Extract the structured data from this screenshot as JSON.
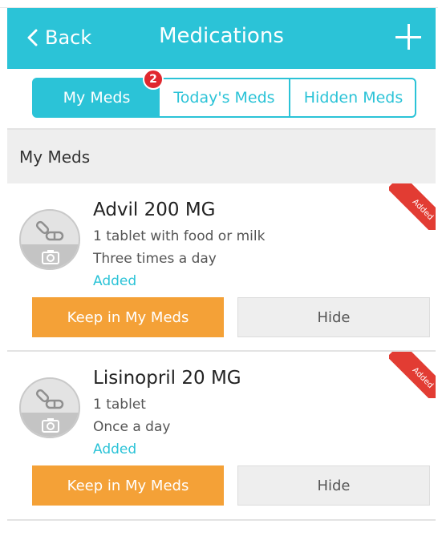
{
  "header": {
    "back_label": "Back",
    "title": "Medications"
  },
  "tabs": [
    {
      "label": "My Meds",
      "active": true,
      "badge": "2"
    },
    {
      "label": "Today's Meds",
      "active": false
    },
    {
      "label": "Hidden Meds",
      "active": false
    }
  ],
  "section": {
    "title": "My Meds"
  },
  "meds": [
    {
      "name": "Advil 200 MG",
      "dose": "1 tablet with food or milk",
      "frequency": "Three times a day",
      "status": "Added",
      "ribbon": "Added",
      "keep_label": "Keep in My Meds",
      "hide_label": "Hide"
    },
    {
      "name": "Lisinopril 20 MG",
      "dose": "1 tablet",
      "frequency": "Once a day",
      "status": "Added",
      "ribbon": "Added",
      "keep_label": "Keep in My Meds",
      "hide_label": "Hide"
    }
  ],
  "colors": {
    "accent": "#2bc3d7",
    "keep_button": "#f4a137",
    "ribbon": "#e23c33",
    "badge": "#e0282e"
  },
  "icons": {
    "back": "chevron-left-icon",
    "add": "plus-icon",
    "pill": "pill-icon",
    "camera": "camera-icon"
  }
}
